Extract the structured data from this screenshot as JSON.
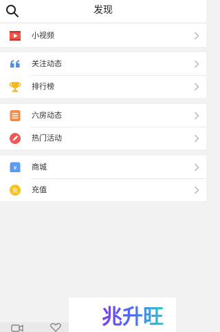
{
  "header": {
    "title": "发现"
  },
  "groups": [
    {
      "items": [
        {
          "label": "小视频",
          "icon": "video-icon"
        }
      ]
    },
    {
      "items": [
        {
          "label": "关注动态",
          "icon": "quote-icon"
        },
        {
          "label": "排行榜",
          "icon": "trophy-icon"
        }
      ]
    },
    {
      "items": [
        {
          "label": "六房动态",
          "icon": "list-icon"
        },
        {
          "label": "热门活动",
          "icon": "pen-icon"
        }
      ]
    },
    {
      "items": [
        {
          "label": "商城",
          "icon": "shop-icon"
        },
        {
          "label": "充值",
          "icon": "recharge-icon"
        }
      ]
    }
  ],
  "icons": {
    "shop_glyph": "¥",
    "recharge_glyph": "充"
  },
  "watermark": {
    "text": "兆升旺"
  },
  "colors": {
    "video": "#f0554b",
    "quote": "#4a8ff0",
    "trophy": "#f2b81e",
    "list": "#f28b45",
    "pen": "#ee5858",
    "shop": "#5b9cf0",
    "recharge": "#f6c21c"
  }
}
